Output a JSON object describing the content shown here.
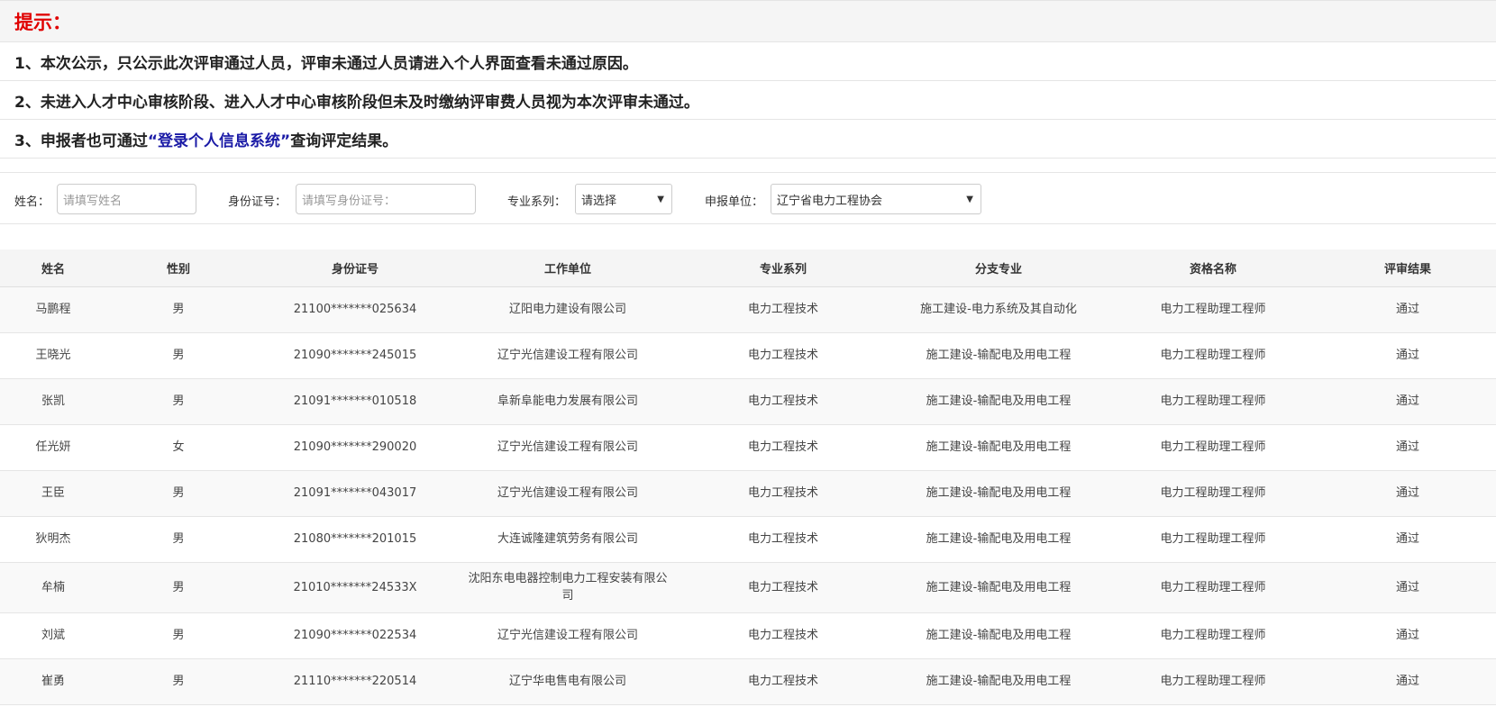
{
  "notice": {
    "title": "提示：",
    "line1": "1、本次公示，只公示此次评审通过人员，评审未通过人员请进入个人界面查看未通过原因。",
    "line2": "2、未进入人才中心审核阶段、进入人才中心审核阶段但未及时缴纳评审费人员视为本次评审未通过。",
    "line3_prefix": "3、申报者也可通过",
    "line3_link": "“登录个人信息系统”",
    "line3_suffix": "查询评定结果。"
  },
  "filter": {
    "name_label": "姓名：",
    "name_placeholder": "请填写姓名",
    "id_label": "身份证号：",
    "id_placeholder": "请填写身份证号：",
    "major_label": "专业系列：",
    "major_value": "请选择",
    "unit_label": "申报单位：",
    "unit_value": "辽宁省电力工程协会"
  },
  "table": {
    "headers": [
      "姓名",
      "性别",
      "身份证号",
      "工作单位",
      "专业系列",
      "分支专业",
      "资格名称",
      "评审结果"
    ],
    "rows": [
      [
        "马鹏程",
        "男",
        "21100*******025634",
        "辽阳电力建设有限公司",
        "电力工程技术",
        "施工建设-电力系统及其自动化",
        "电力工程助理工程师",
        "通过"
      ],
      [
        "王晓光",
        "男",
        "21090*******245015",
        "辽宁光信建设工程有限公司",
        "电力工程技术",
        "施工建设-输配电及用电工程",
        "电力工程助理工程师",
        "通过"
      ],
      [
        "张凯",
        "男",
        "21091*******010518",
        "阜新阜能电力发展有限公司",
        "电力工程技术",
        "施工建设-输配电及用电工程",
        "电力工程助理工程师",
        "通过"
      ],
      [
        "任光妍",
        "女",
        "21090*******290020",
        "辽宁光信建设工程有限公司",
        "电力工程技术",
        "施工建设-输配电及用电工程",
        "电力工程助理工程师",
        "通过"
      ],
      [
        "王臣",
        "男",
        "21091*******043017",
        "辽宁光信建设工程有限公司",
        "电力工程技术",
        "施工建设-输配电及用电工程",
        "电力工程助理工程师",
        "通过"
      ],
      [
        "狄明杰",
        "男",
        "21080*******201015",
        "大连诚隆建筑劳务有限公司",
        "电力工程技术",
        "施工建设-输配电及用电工程",
        "电力工程助理工程师",
        "通过"
      ],
      [
        "牟楠",
        "男",
        "21010*******24533X",
        "沈阳东电电器控制电力工程安装有限公司",
        "电力工程技术",
        "施工建设-输配电及用电工程",
        "电力工程助理工程师",
        "通过"
      ],
      [
        "刘斌",
        "男",
        "21090*******022534",
        "辽宁光信建设工程有限公司",
        "电力工程技术",
        "施工建设-输配电及用电工程",
        "电力工程助理工程师",
        "通过"
      ],
      [
        "崔勇",
        "男",
        "21110*******220514",
        "辽宁华电售电有限公司",
        "电力工程技术",
        "施工建设-输配电及用电工程",
        "电力工程助理工程师",
        "通过"
      ]
    ]
  }
}
